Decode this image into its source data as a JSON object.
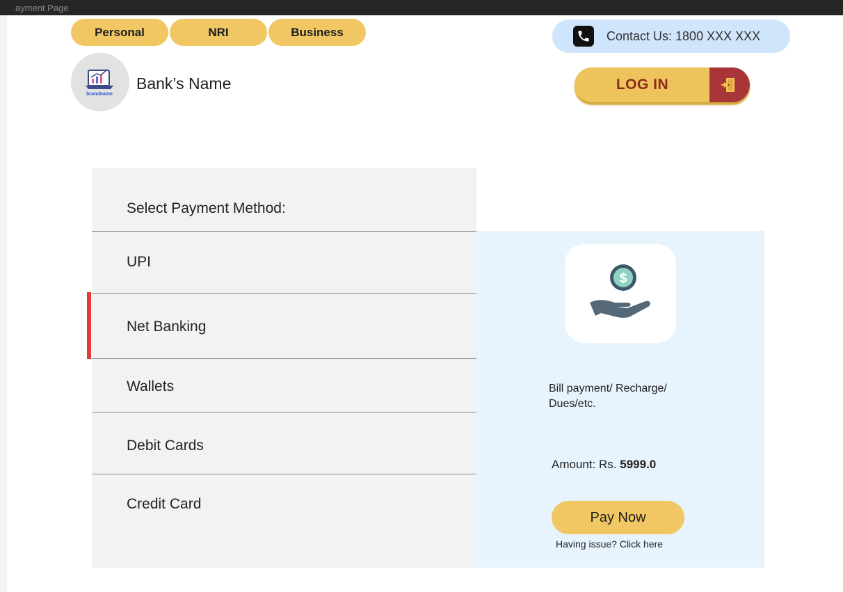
{
  "window": {
    "title": "ayment Page"
  },
  "nav": {
    "tabs": [
      "Personal",
      "NRI",
      "Business"
    ]
  },
  "contact": {
    "label": "Contact Us: 1800 XXX XXX",
    "icon": "phone-icon"
  },
  "brand": {
    "logo_text": "brandname",
    "bank_name": "Bank’s Name"
  },
  "login": {
    "label": "LOG IN",
    "icon": "door-exit-icon"
  },
  "payment_methods": {
    "heading": "Select Payment Method:",
    "items": [
      "UPI",
      "Net Banking",
      "Wallets",
      "Debit Cards",
      "Credit Card"
    ],
    "selected": "Net Banking"
  },
  "summary": {
    "icon": "hand-coin-icon",
    "description": "Bill payment/ Recharge/ Dues/etc.",
    "amount_label": "Amount: Rs. ",
    "amount_value": "5999.0",
    "pay_button": "Pay Now",
    "help_link": "Having issue? Click here"
  },
  "colors": {
    "tab": "#f1c764",
    "contact_bg": "#cfe5fb",
    "login_bg": "#edc35b",
    "login_door": "#a83638",
    "selection_indicator": "#e53a36",
    "summary_bg": "#e7f3fd"
  }
}
